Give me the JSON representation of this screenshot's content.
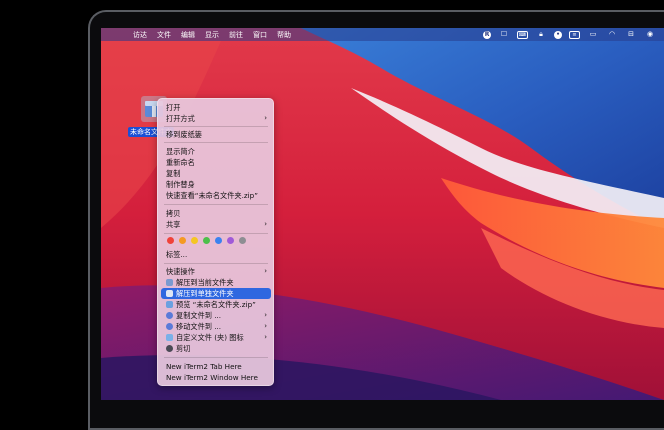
{
  "menubar": {
    "apple": "",
    "items": [
      "访达",
      "文件",
      "编辑",
      "显示",
      "前往",
      "窗口",
      "帮助"
    ]
  },
  "desktop_file": {
    "label": "未命名文件夹"
  },
  "context_menu": {
    "open": "打开",
    "open_with": "打开方式",
    "move_to_trash": "移到废纸篓",
    "get_info": "显示简介",
    "rename": "重新命名",
    "duplicate": "复制",
    "make_alias": "制作替身",
    "quick_look": "快速查看“未命名文件夹.zip”",
    "copy": "拷贝",
    "share": "共享",
    "tags": "标签...",
    "quick_actions": "快速操作",
    "extract_here": "解压到当前文件夹",
    "extract_separate": "解压到单独文件夹",
    "preview": "预览 “未命名文件夹.zip”",
    "copy_to": "复制文件到 ...",
    "move_to": "移动文件到 ...",
    "custom_icon": "自定义文件 (夹) 图标",
    "cut": "剪切",
    "iterm_tab": "New iTerm2 Tab Here",
    "iterm_window": "New iTerm2 Window Here",
    "tag_colors": [
      "#f0423a",
      "#f59a23",
      "#f5c623",
      "#4cc04a",
      "#3b82f0",
      "#a05ad8",
      "#8e8e93"
    ]
  }
}
